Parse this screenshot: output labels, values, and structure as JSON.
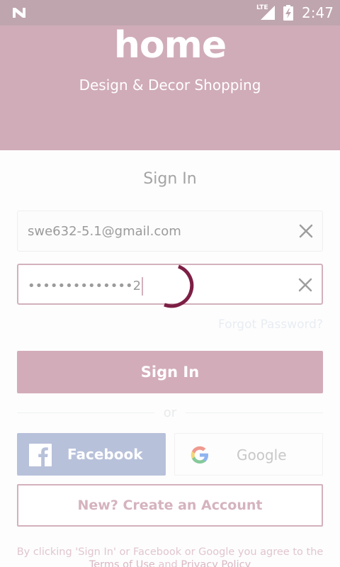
{
  "status_bar": {
    "network": "LTE",
    "time": "2:47"
  },
  "header": {
    "logo": "home",
    "tagline": "Design & Decor Shopping"
  },
  "form": {
    "title": "Sign In",
    "email_value": "swe632-5.1@gmail.com",
    "password_value": "••••••••••••••2",
    "forgot_label": "Forgot Password?",
    "signin_label": "Sign In"
  },
  "divider": {
    "or_label": "or"
  },
  "social": {
    "facebook_label": "Facebook",
    "google_label": "Google"
  },
  "create_label": "New? Create an Account",
  "legal": {
    "text": "By clicking 'Sign In' or Facebook or Google you agree to the",
    "terms_label": "Terms of Use",
    "and_label": "and",
    "privacy_label": "Privacy Policy"
  },
  "colors": {
    "header": "#d0acb8",
    "status_bar": "#bfa5ae",
    "accent": "#d3acb9",
    "spinner": "#7d1f45",
    "facebook": "#b8c1da"
  },
  "icons": {
    "status": [
      "n-icon",
      "signal-icon",
      "battery-icon"
    ],
    "fields": [
      "close-icon"
    ],
    "social": [
      "facebook-icon",
      "google-icon"
    ]
  }
}
